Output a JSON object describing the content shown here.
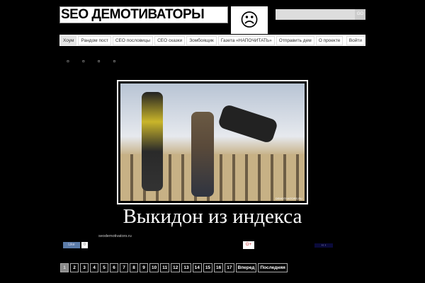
{
  "header": {
    "logo_text": "SEO ДЕМОТИВАТОРЫ",
    "search_placeholder": "",
    "search_button": "GO"
  },
  "nav": {
    "items": [
      "Хоум",
      "Рандом пост",
      "СЕО пословицы",
      "СЕО сказки",
      "Зомбоящик",
      "Газета «НАПОЧИТАТЬ»",
      "Отправить дем",
      "О проекте"
    ],
    "login": "Войти"
  },
  "meta_row": "¤ ¤ ¤ ¤",
  "post": {
    "watermark": "DEMOTIVATORS.RU",
    "caption": "Выкидон из индекса",
    "site": "seodemotivators.ru"
  },
  "social": {
    "like": "Like",
    "like_count": "0",
    "gplus": "G+",
    "nav_arrows": "‹‹ ›"
  },
  "pagination": {
    "pages": [
      "1",
      "2",
      "3",
      "4",
      "5",
      "6",
      "7",
      "8",
      "9",
      "10",
      "11",
      "12",
      "13",
      "14",
      "15",
      "16",
      "17"
    ],
    "current": "1",
    "next": "Вперед",
    "last": "Последняя"
  }
}
